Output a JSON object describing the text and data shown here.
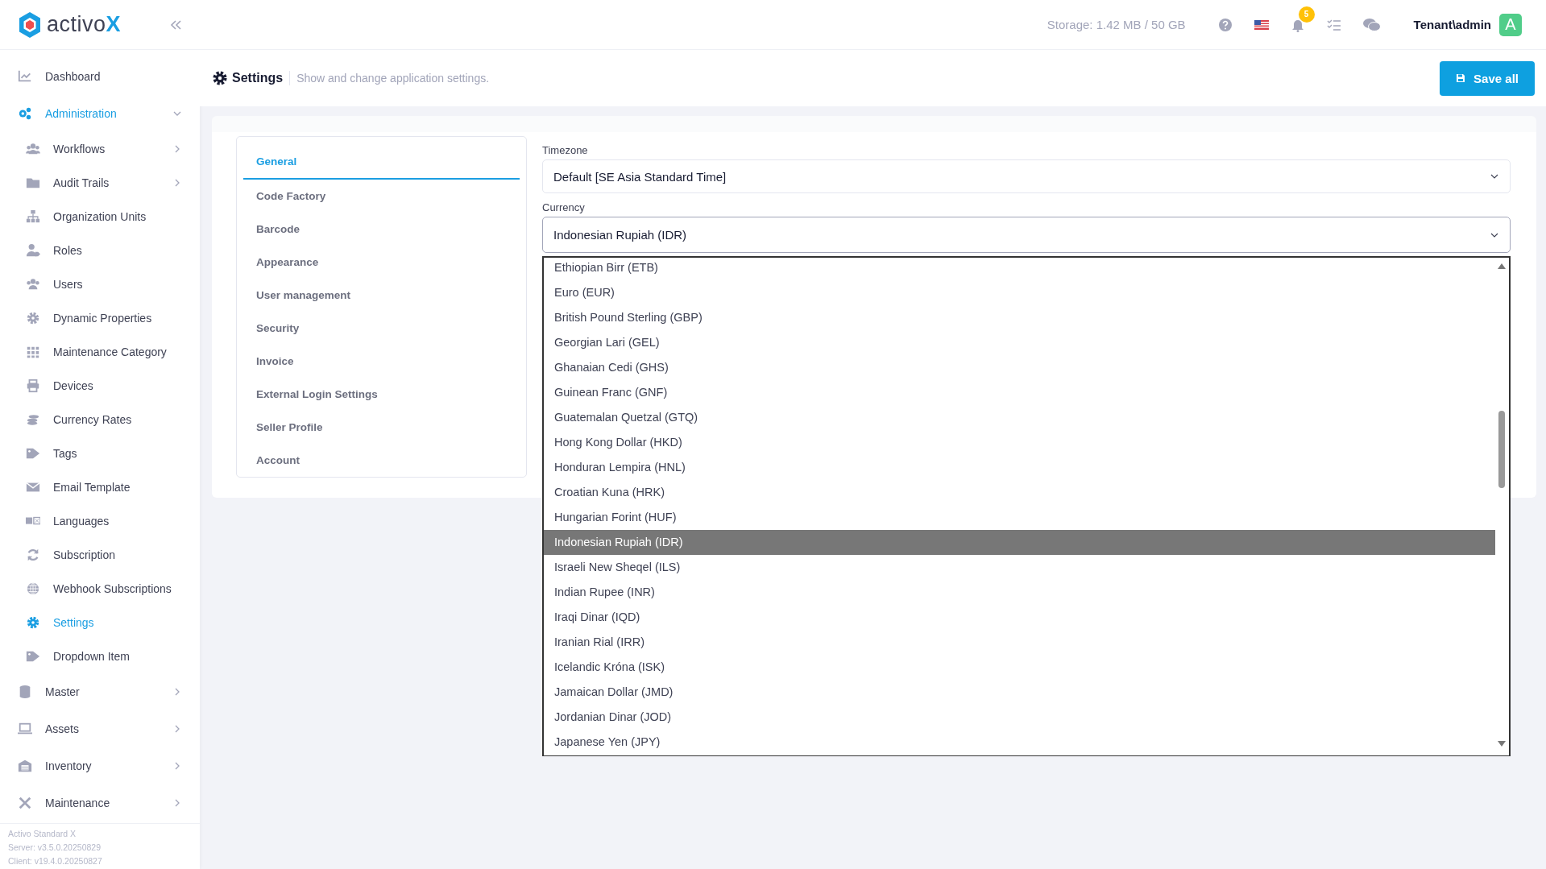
{
  "brand": {
    "name": "activo",
    "mark": "X"
  },
  "sidebar": {
    "items": [
      {
        "label": "Dashboard",
        "selected": false
      },
      {
        "label": "Administration",
        "selected": true,
        "expanded": true,
        "children": [
          {
            "label": "Workflows",
            "selected": false,
            "expanded": false
          },
          {
            "label": "Audit Trails",
            "selected": false,
            "expanded": false
          },
          {
            "label": "Organization Units",
            "selected": false
          },
          {
            "label": "Roles",
            "selected": false
          },
          {
            "label": "Users",
            "selected": false
          },
          {
            "label": "Dynamic Properties",
            "selected": false
          },
          {
            "label": "Maintenance Category",
            "selected": false
          },
          {
            "label": "Devices",
            "selected": false
          },
          {
            "label": "Currency Rates",
            "selected": false
          },
          {
            "label": "Tags",
            "selected": false
          },
          {
            "label": "Email Template",
            "selected": false
          },
          {
            "label": "Languages",
            "selected": false
          },
          {
            "label": "Subscription",
            "selected": false
          },
          {
            "label": "Webhook Subscriptions",
            "selected": false
          },
          {
            "label": "Settings",
            "selected": true
          },
          {
            "label": "Dropdown Item",
            "selected": false
          }
        ]
      },
      {
        "label": "Master",
        "selected": false,
        "expanded": false
      },
      {
        "label": "Assets",
        "selected": false,
        "expanded": false
      },
      {
        "label": "Inventory",
        "selected": false,
        "expanded": false
      },
      {
        "label": "Maintenance",
        "selected": false,
        "expanded": false
      }
    ],
    "footer": [
      "Activo Standard X",
      "Server: v3.5.0.20250829",
      "Client: v19.4.0.20250827"
    ]
  },
  "topbar": {
    "storage": "Storage: 1.42 MB / 50 GB",
    "notifications": "5",
    "user": "Tenant\\admin",
    "avatar": "A"
  },
  "header": {
    "title": "Settings",
    "description": "Show and change application settings.",
    "save_button": "Save all"
  },
  "settings_tabs": [
    {
      "label": "General",
      "selected": true
    },
    {
      "label": "Code Factory",
      "selected": false
    },
    {
      "label": "Barcode",
      "selected": false
    },
    {
      "label": "Appearance",
      "selected": false
    },
    {
      "label": "User management",
      "selected": false
    },
    {
      "label": "Security",
      "selected": false
    },
    {
      "label": "Invoice",
      "selected": false
    },
    {
      "label": "External Login Settings",
      "selected": false
    },
    {
      "label": "Seller Profile",
      "selected": false
    },
    {
      "label": "Account",
      "selected": false
    }
  ],
  "fields": [
    {
      "label": "Timezone",
      "value": "Default [SE Asia Standard Time]",
      "expanded": false
    },
    {
      "label": "Currency",
      "value": "Indonesian Rupiah (IDR)",
      "expanded": true
    }
  ],
  "currency_options": [
    {
      "label": "Ethiopian Birr (ETB)",
      "selected": false
    },
    {
      "label": "Euro (EUR)",
      "selected": false
    },
    {
      "label": "British Pound Sterling (GBP)",
      "selected": false
    },
    {
      "label": "Georgian Lari (GEL)",
      "selected": false
    },
    {
      "label": "Ghanaian Cedi (GHS)",
      "selected": false
    },
    {
      "label": "Guinean Franc (GNF)",
      "selected": false
    },
    {
      "label": "Guatemalan Quetzal (GTQ)",
      "selected": false
    },
    {
      "label": "Hong Kong Dollar (HKD)",
      "selected": false
    },
    {
      "label": "Honduran Lempira (HNL)",
      "selected": false
    },
    {
      "label": "Croatian Kuna (HRK)",
      "selected": false
    },
    {
      "label": "Hungarian Forint (HUF)",
      "selected": false
    },
    {
      "label": "Indonesian Rupiah (IDR)",
      "selected": true
    },
    {
      "label": "Israeli New Sheqel (ILS)",
      "selected": false
    },
    {
      "label": "Indian Rupee (INR)",
      "selected": false
    },
    {
      "label": "Iraqi Dinar (IQD)",
      "selected": false
    },
    {
      "label": "Iranian Rial (IRR)",
      "selected": false
    },
    {
      "label": "Icelandic Króna (ISK)",
      "selected": false
    },
    {
      "label": "Jamaican Dollar (JMD)",
      "selected": false
    },
    {
      "label": "Jordanian Dinar (JOD)",
      "selected": false
    },
    {
      "label": "Japanese Yen (JPY)",
      "selected": false
    }
  ]
}
